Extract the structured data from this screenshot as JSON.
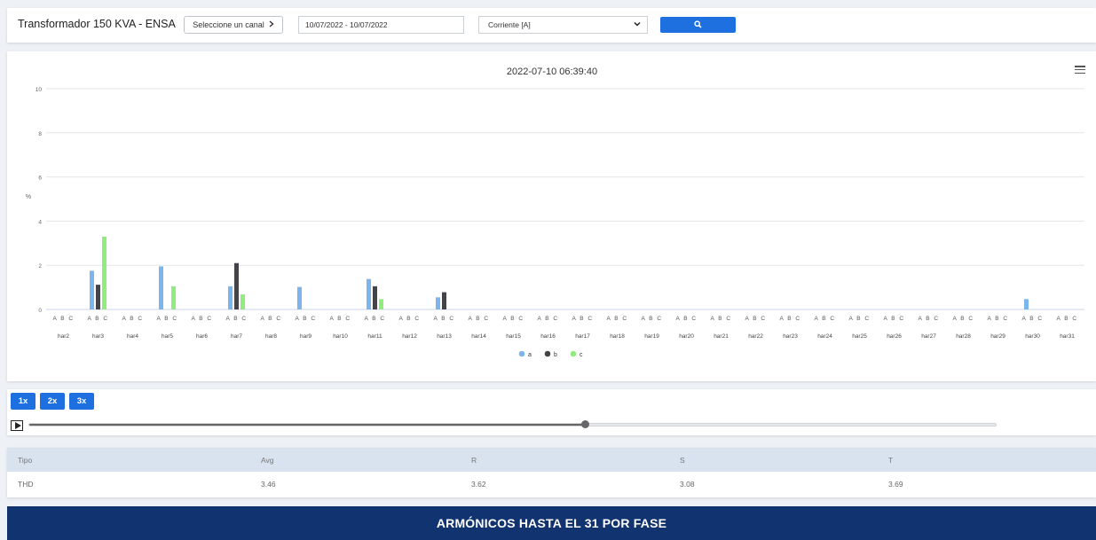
{
  "header": {
    "device_title": "Transformador 150 KVA - ENSA",
    "channel_button_label": "Seleccione un canal",
    "date_range": "10/07/2022 - 10/07/2022",
    "measure_selected": "Corriente [A]",
    "accent_color": "#1e6fe0"
  },
  "chart_data": {
    "type": "bar",
    "title": "2022-07-10 06:39:40",
    "xlabel": "",
    "ylabel": "%",
    "ylim": [
      0,
      10
    ],
    "yticks": [
      0,
      2,
      4,
      6,
      8,
      10
    ],
    "sublabels": "A B C",
    "categories": [
      "har2",
      "har3",
      "har4",
      "har5",
      "har6",
      "har7",
      "har8",
      "har9",
      "har10",
      "har11",
      "har12",
      "har13",
      "har14",
      "har15",
      "har16",
      "har17",
      "har18",
      "har19",
      "har20",
      "har21",
      "har22",
      "har23",
      "har24",
      "har25",
      "har26",
      "har27",
      "har28",
      "har29",
      "har30",
      "har31"
    ],
    "series": [
      {
        "name": "a",
        "color": "#7cb5ec",
        "values": [
          0,
          1.75,
          0,
          1.95,
          0,
          1.05,
          0,
          1.02,
          0,
          1.38,
          0,
          0.55,
          0,
          0,
          0,
          0,
          0,
          0,
          0,
          0,
          0,
          0,
          0,
          0,
          0,
          0,
          0,
          0,
          0.47,
          0
        ]
      },
      {
        "name": "b",
        "color": "#434348",
        "values": [
          0,
          1.12,
          0,
          0,
          0,
          2.1,
          0,
          0,
          0,
          1.05,
          0,
          0.78,
          0,
          0,
          0,
          0,
          0,
          0,
          0,
          0,
          0,
          0,
          0,
          0,
          0,
          0,
          0,
          0,
          0,
          0
        ]
      },
      {
        "name": "c",
        "color": "#90ed7d",
        "values": [
          0,
          3.3,
          0,
          1.05,
          0,
          0.68,
          0,
          0,
          0,
          0.47,
          0,
          0,
          0,
          0,
          0,
          0,
          0,
          0,
          0,
          0,
          0,
          0,
          0,
          0,
          0,
          0,
          0,
          0,
          0,
          0
        ]
      }
    ],
    "grid": true,
    "legend": "bottom-center"
  },
  "playback": {
    "speeds": [
      "1x",
      "2x",
      "3x"
    ],
    "progress": 0.575
  },
  "thd_table": {
    "headers": [
      "Tipo",
      "Avg",
      "R",
      "S",
      "T"
    ],
    "rows": [
      [
        "THD",
        "3.46",
        "3.62",
        "3.08",
        "3.69"
      ]
    ]
  },
  "footer": {
    "text": "ARMÓNICOS HASTA EL 31 POR FASE",
    "color": "#113370"
  }
}
